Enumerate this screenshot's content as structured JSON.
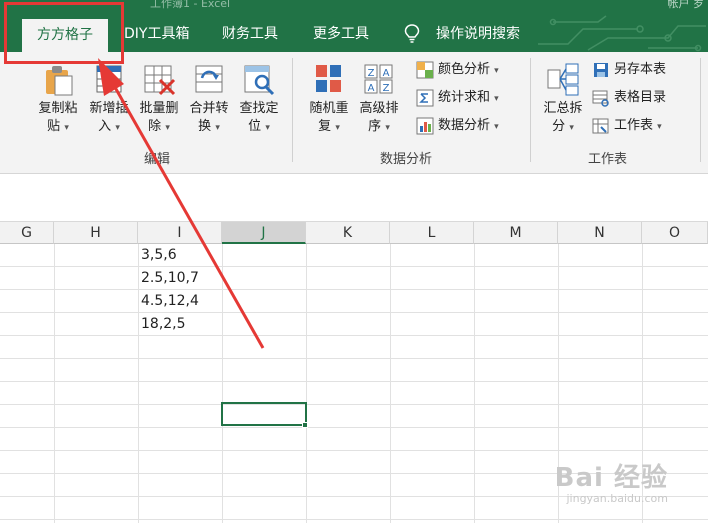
{
  "window": {
    "title": "工作簿1 - Excel",
    "user": "帐户 岁"
  },
  "tabs": [
    {
      "label": "方方格子",
      "active": true
    },
    {
      "label": "DIY工具箱"
    },
    {
      "label": "财务工具"
    },
    {
      "label": "更多工具"
    },
    {
      "label": "操作说明搜索"
    }
  ],
  "ribbon": {
    "edit_group": {
      "label": "编辑",
      "buttons": [
        {
          "line1": "复制粘",
          "line2": "贴"
        },
        {
          "line1": "新增插",
          "line2": "入"
        },
        {
          "line1": "批量删",
          "line2": "除"
        },
        {
          "line1": "合并转",
          "line2": "换"
        },
        {
          "line1": "查找定",
          "line2": "位"
        }
      ]
    },
    "analysis_group": {
      "label": "数据分析",
      "buttons": [
        {
          "line1": "随机重",
          "line2": "复"
        },
        {
          "line1": "高级排",
          "line2": "序"
        }
      ],
      "small": [
        "颜色分析",
        "统计求和",
        "数据分析"
      ]
    },
    "sheet_group": {
      "label": "工作表",
      "big": {
        "line1": "汇总拆",
        "line2": "分"
      },
      "small": [
        "另存本表",
        "表格目录",
        "工作表"
      ]
    }
  },
  "grid": {
    "columns": [
      "G",
      "H",
      "I",
      "J",
      "K",
      "L",
      "M",
      "N",
      "O"
    ],
    "selected_column": "J",
    "cells": [
      "3,5,6",
      "2.5,10,7",
      "4.5,12,4",
      "18,2,5"
    ]
  },
  "colors": {
    "brand": "#217346",
    "annotation": "#e53935"
  },
  "watermark": {
    "text": "Bai 经验",
    "url": "jingyan.baidu.com"
  }
}
